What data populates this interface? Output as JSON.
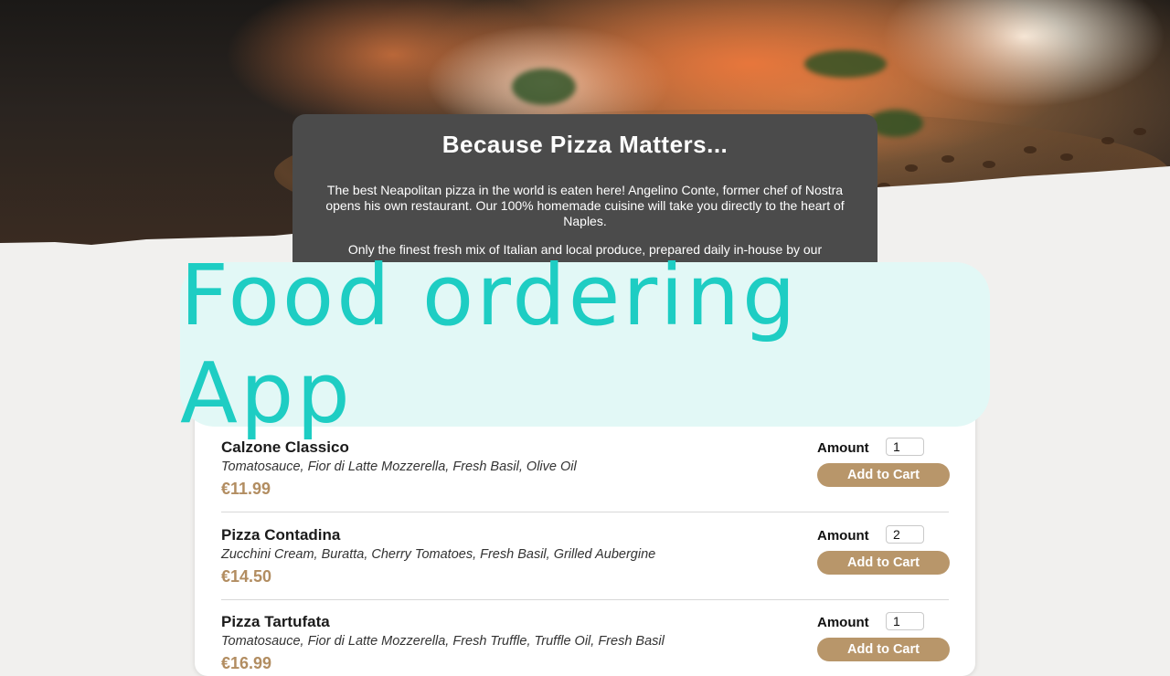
{
  "intro": {
    "title": "Because Pizza Matters...",
    "paragraph1": "The best Neapolitan pizza in the world is eaten here! Angelino Conte, former chef of Nostra opens his own restaurant. Our 100% homemade cuisine will take you directly to the heart of Naples.",
    "paragraph2": "Only the finest fresh mix of Italian and local produce, prepared daily in-house by our"
  },
  "banner": {
    "text": "Food ordering App"
  },
  "menu": {
    "amount_label": "Amount",
    "add_label": "Add to Cart",
    "meals": [
      {
        "name": "Calzone Classico",
        "description": "Tomatosauce, Fior di Latte Mozzerella, Fresh Basil, Olive Oil",
        "price": "€11.99",
        "amount": "1"
      },
      {
        "name": "Pizza Contadina",
        "description": "Zucchini Cream, Buratta, Cherry Tomatoes, Fresh Basil, Grilled Aubergine",
        "price": "€14.50",
        "amount": "2"
      },
      {
        "name": "Pizza Tartufata",
        "description": "Tomatosauce, Fior di Latte Mozzerella, Fresh Truffle, Truffle Oil, Fresh Basil",
        "price": "€16.99",
        "amount": "1"
      }
    ]
  },
  "colors": {
    "accent": "#b8966a",
    "price": "#b28d61",
    "banner_bg": "#e2f8f6",
    "banner_text": "#1ecdc3",
    "intro_bg": "#4b4b4b"
  }
}
